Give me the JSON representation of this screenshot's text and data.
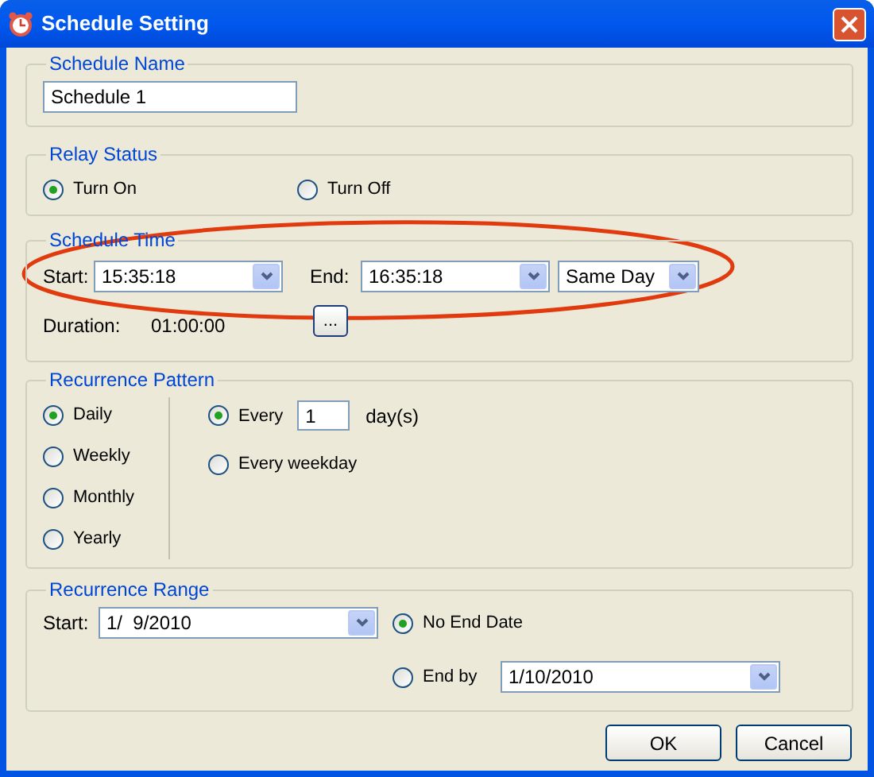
{
  "window": {
    "title": "Schedule Setting"
  },
  "schedule_name": {
    "legend": "Schedule Name",
    "value": "Schedule 1"
  },
  "relay_status": {
    "legend": "Relay Status",
    "options": [
      {
        "label": "Turn On",
        "selected": true
      },
      {
        "label": "Turn Off",
        "selected": false
      }
    ]
  },
  "schedule_time": {
    "legend": "Schedule Time",
    "start_label": "Start:",
    "start_value": "15:35:18",
    "end_label": "End:",
    "end_value": "16:35:18",
    "day_value": "Same Day",
    "duration_label": "Duration:",
    "duration_value": "01:00:00",
    "more_button": "..."
  },
  "recurrence_pattern": {
    "legend": "Recurrence Pattern",
    "frequencies": [
      {
        "label": "Daily",
        "selected": true
      },
      {
        "label": "Weekly",
        "selected": false
      },
      {
        "label": "Monthly",
        "selected": false
      },
      {
        "label": "Yearly",
        "selected": false
      }
    ],
    "options": [
      {
        "kind": "interval",
        "label": "Every",
        "selected": true,
        "value": "1",
        "unit": "day(s)"
      },
      {
        "kind": "plain",
        "label": "Every weekday",
        "selected": false
      }
    ]
  },
  "recurrence_range": {
    "legend": "Recurrence Range",
    "start_label": "Start:",
    "start_value": "1/  9/2010",
    "end_options": [
      {
        "kind": "plain",
        "label": "No End Date",
        "selected": true
      },
      {
        "kind": "date",
        "label": "End by",
        "selected": false,
        "value": "1/10/2010"
      }
    ]
  },
  "buttons": [
    {
      "label": "OK"
    },
    {
      "label": "Cancel"
    }
  ]
}
